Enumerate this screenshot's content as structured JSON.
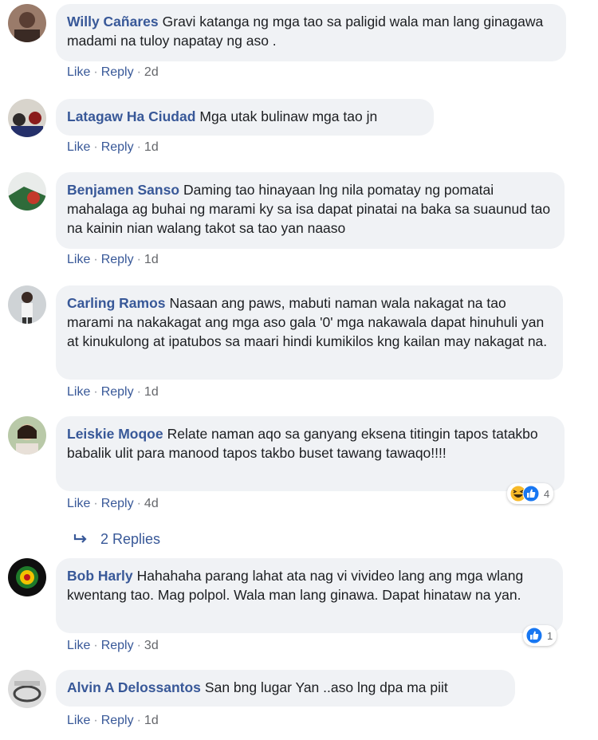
{
  "comments": [
    {
      "author": "Willy Cañares",
      "text": "Gravi katanga ng mga tao sa paligid wala man lang ginagawa madami na tuloy napatay ng aso .",
      "like": "Like",
      "reply": "Reply",
      "time": "2d"
    },
    {
      "author": "Latagaw Ha Ciudad",
      "text": "Mga utak bulinaw mga tao jn",
      "like": "Like",
      "reply": "Reply",
      "time": "1d"
    },
    {
      "author": "Benjamen Sanso",
      "text": "Daming tao hinayaan lng nila pomatay ng pomatai mahalaga ag buhai ng marami ky sa isa dapat pinatai na baka sa suaunud tao na kainin nian walang takot sa tao yan naaso",
      "like": "Like",
      "reply": "Reply",
      "time": "1d"
    },
    {
      "author": "Carling Ramos",
      "text": "Nasaan ang paws, mabuti naman wala nakagat na tao marami na nakakagat ang mga aso gala '0' mga nakawala dapat hinuhuli yan at kinukulong at ipatubos sa maari hindi kumikilos kng kailan may nakagat na.",
      "like": "Like",
      "reply": "Reply",
      "time": "1d"
    },
    {
      "author": "Leiskie Moqoe",
      "text": "Relate naman aqo sa ganyang eksena titingin tapos tatakbo babalik ulit para manood tapos takbo buset tawang tawaqo!!!!",
      "like": "Like",
      "reply": "Reply",
      "time": "4d",
      "reaction_count": "4",
      "reaction_icons": [
        "haha-icon",
        "like-icon"
      ]
    },
    {
      "author": "Bob Harly",
      "text": "Hahahaha parang lahat ata nag vi vivideo lang ang mga wlang kwentang tao. Mag polpol. Wala man lang ginawa. Dapat hinataw na yan.",
      "like": "Like",
      "reply": "Reply",
      "time": "3d",
      "reaction_count": "1",
      "reaction_icons": [
        "like-icon"
      ]
    },
    {
      "author": "Alvin A Delossantos",
      "text": "San bng lugar Yan ..aso lng dpa ma piit",
      "like": "Like",
      "reply": "Reply",
      "time": "1d"
    }
  ],
  "replies_link": {
    "label": "2 Replies",
    "icon": "reply-arrow-icon"
  },
  "colors": {
    "author": "#385898",
    "bubble": "#f0f2f5",
    "meta": "#65676b",
    "like_blue": "#1877f2",
    "haha_yellow": "#f7b928"
  }
}
